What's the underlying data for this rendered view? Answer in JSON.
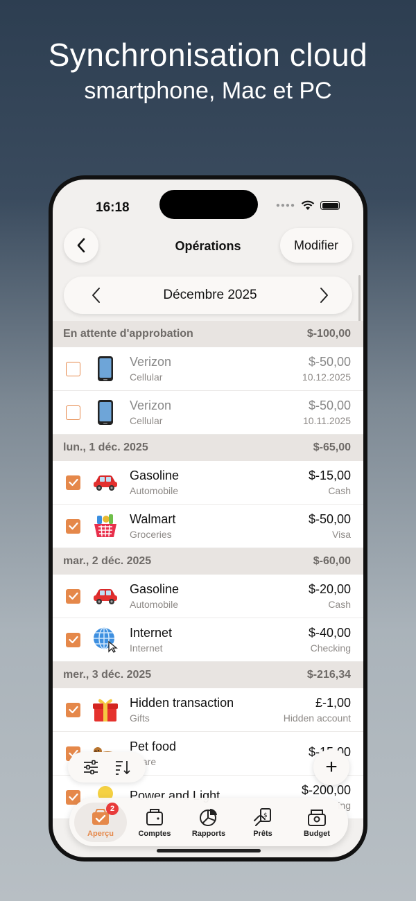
{
  "promo": {
    "title": "Synchronisation cloud",
    "subtitle": "smartphone, Mac et PC"
  },
  "status": {
    "time": "16:18"
  },
  "nav": {
    "title": "Opérations",
    "edit_label": "Modifier",
    "back_icon": "chevron-left-icon"
  },
  "month": {
    "label": "Décembre 2025"
  },
  "sections": [
    {
      "title": "En attente d'approbation",
      "total": "$-100,00",
      "rows": [
        {
          "name": "Verizon",
          "category": "Cellular",
          "amount": "$-50,00",
          "sub": "10.12.2025",
          "icon": "phone-icon",
          "checked": false
        },
        {
          "name": "Verizon",
          "category": "Cellular",
          "amount": "$-50,00",
          "sub": "10.11.2025",
          "icon": "phone-icon",
          "checked": false
        }
      ]
    },
    {
      "title": "lun., 1 déc. 2025",
      "total": "$-65,00",
      "rows": [
        {
          "name": "Gasoline",
          "category": "Automobile",
          "amount": "$-15,00",
          "sub": "Cash",
          "icon": "car-icon",
          "checked": true
        },
        {
          "name": "Walmart",
          "category": "Groceries",
          "amount": "$-50,00",
          "sub": "Visa",
          "icon": "grocery-basket-icon",
          "checked": true
        }
      ]
    },
    {
      "title": "mar., 2 déc. 2025",
      "total": "$-60,00",
      "rows": [
        {
          "name": "Gasoline",
          "category": "Automobile",
          "amount": "$-20,00",
          "sub": "Cash",
          "icon": "car-icon",
          "checked": true
        },
        {
          "name": "Internet",
          "category": "Internet",
          "amount": "$-40,00",
          "sub": "Checking",
          "icon": "globe-icon",
          "checked": true
        }
      ]
    },
    {
      "title": "mer., 3 déc. 2025",
      "total": "$-216,34",
      "rows": [
        {
          "name": "Hidden transaction",
          "category": "Gifts",
          "amount": "£-1,00",
          "sub": "Hidden account",
          "icon": "gift-icon",
          "checked": true
        },
        {
          "name": "Pet food",
          "category": "t Care",
          "amount": "$-15.00",
          "sub": "",
          "icon": "dog-icon",
          "checked": true
        },
        {
          "name": "Power and Light",
          "category": "",
          "amount": "$-200,00",
          "sub": "ing",
          "icon": "lightbulb-icon",
          "checked": true
        }
      ]
    }
  ],
  "fab_label": "+",
  "tabs": [
    {
      "label": "Aperçu",
      "icon": "overview-icon",
      "badge": "2",
      "active": true
    },
    {
      "label": "Comptes",
      "icon": "wallet-icon",
      "active": false
    },
    {
      "label": "Rapports",
      "icon": "pie-chart-icon",
      "active": false
    },
    {
      "label": "Prêts",
      "icon": "loan-icon",
      "active": false
    },
    {
      "label": "Budget",
      "icon": "budget-icon",
      "active": false
    }
  ],
  "colors": {
    "accent": "#e5884a",
    "badge": "#e83a3a"
  }
}
